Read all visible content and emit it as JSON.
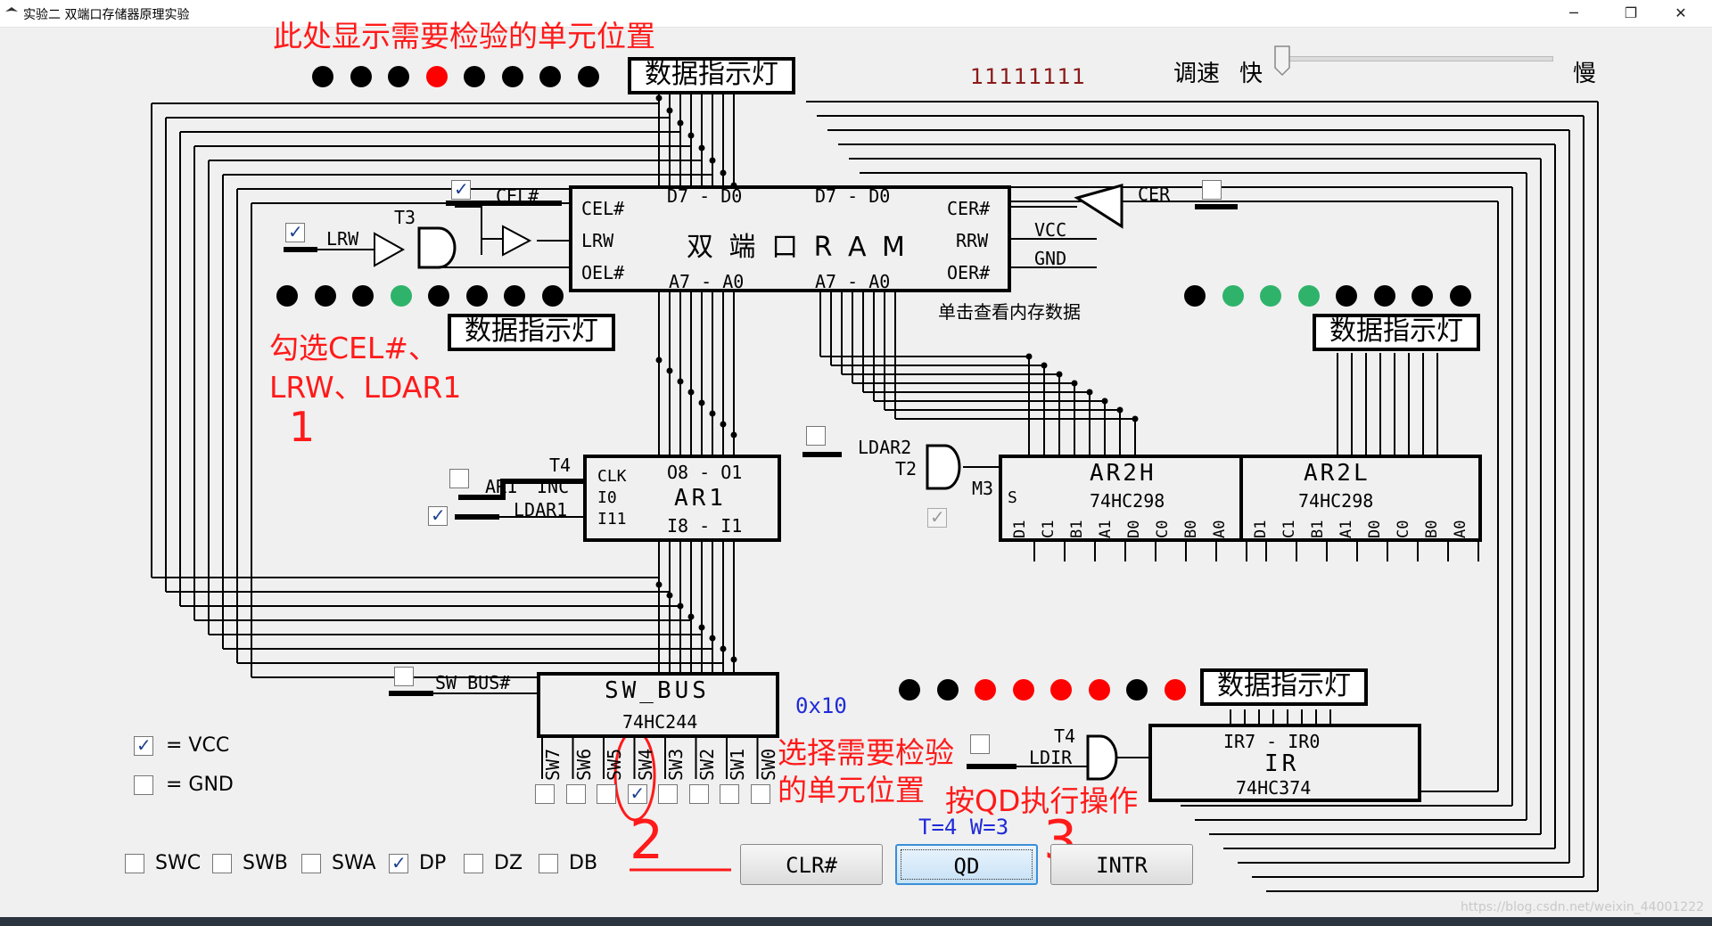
{
  "window": {
    "title": "实验二 双端口存储器原理实验",
    "minimize_glyph": "─",
    "restore_glyph": "❐",
    "close_glyph": "✕"
  },
  "speed": {
    "label": "调速",
    "fast": "快",
    "slow": "慢",
    "level": 0
  },
  "bus_value": "11111111",
  "ram": {
    "title": "双 端 口   R A M",
    "cel": "CEL#",
    "lrw": "LRW",
    "oel": "OEL#",
    "cer": "CER#",
    "rrw": "RRW",
    "oer": "OER#",
    "data_left": "D7 - D0",
    "data_right": "D7 - D0",
    "addr_left": "A7 - A0",
    "addr_right": "A7 - A0",
    "hint": "单击查看内存数据"
  },
  "signals": {
    "cel": "CEL#",
    "lrw": "LRW",
    "t3": "T3",
    "cer": "CER",
    "vcc": "VCC",
    "gnd": "GND",
    "t4": "T4",
    "ar1": "AR1",
    "inc": "INC",
    "ldar1": "LDAR1",
    "ldar2": "LDAR2",
    "t2": "T2",
    "m3": "M3",
    "sw_bus": "SW_BUS#",
    "ldir": "LDIR",
    "t4b": "T4"
  },
  "ar1": {
    "name": "AR1",
    "clk": "CLK",
    "i0": "I0",
    "i11": "I11",
    "top": "O8 - O1",
    "bottom": "I8 - I1"
  },
  "ar2h": {
    "name": "AR2H",
    "chip": "74HC298",
    "s": "S",
    "pins": [
      "D1",
      "C1",
      "B1",
      "A1",
      "D0",
      "C0",
      "B0",
      "A0"
    ]
  },
  "ar2l": {
    "name": "AR2L",
    "chip": "74HC298",
    "pins": [
      "D1",
      "C1",
      "B1",
      "A1",
      "D0",
      "C0",
      "B0",
      "A0"
    ]
  },
  "swbus": {
    "name": "SW_BUS",
    "chip": "74HC244",
    "switches": [
      "SW7",
      "SW6",
      "SW5",
      "SW4",
      "SW3",
      "SW2",
      "SW1",
      "SW0"
    ]
  },
  "ir": {
    "name": "IR",
    "chip": "74HC374",
    "top": "IR7 - IR0"
  },
  "indicator_label": "数据指示灯",
  "legend": {
    "vcc": "=  VCC",
    "gnd": "=  GND"
  },
  "modes": {
    "swc": "SWC",
    "swb": "SWB",
    "swa": "SWA",
    "dp": "DP",
    "dz": "DZ",
    "db": "DB"
  },
  "buttons": {
    "clr": "CLR#",
    "qd": "QD",
    "intr": "INTR"
  },
  "hex_value": "0x10",
  "timing": "T=4 W=3",
  "annotations": {
    "top": "此处显示需要检验的单元位置",
    "left_1": "勾选CEL#、",
    "left_2": "LRW、LDAR1",
    "left_mark": "1",
    "select_1": "选择需要检验",
    "select_2": "的单元位置",
    "qd": "按QD执行操作",
    "mark2": "2",
    "mark3": "3"
  },
  "watermark": "https://blog.csdn.net/weixin_44001222",
  "colors": {
    "off": "#000000",
    "red": "#ff0000",
    "green": "#2fb36b",
    "wire": "#000000",
    "annot": "#ff1a1a",
    "blue": "#1f2bd8"
  },
  "leds": {
    "top": [
      "off",
      "off",
      "off",
      "red",
      "off",
      "off",
      "off",
      "off"
    ],
    "mid_left": [
      "off",
      "off",
      "off",
      "green",
      "off",
      "off",
      "off",
      "off"
    ],
    "mid_right": [
      "off",
      "green",
      "green",
      "green",
      "off",
      "off",
      "off",
      "off"
    ],
    "ir": [
      "off",
      "off",
      "red",
      "red",
      "red",
      "red",
      "off",
      "red"
    ]
  }
}
